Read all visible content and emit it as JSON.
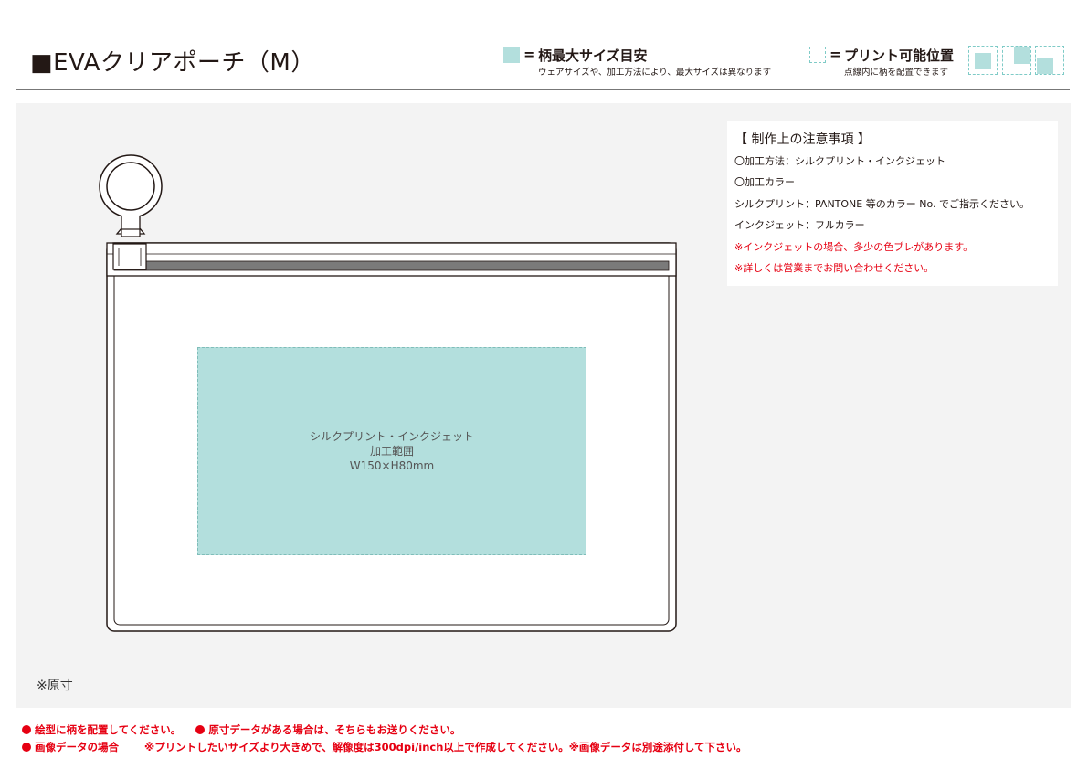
{
  "header": {
    "title": "■EVAクリアポーチ（M）",
    "legend_pattern": {
      "equals": "=",
      "label": "柄最大サイズ目安",
      "note": "ウェアサイズや、加工方法により、最大サイズは異なります",
      "color": "#b3dfdd"
    },
    "legend_position": {
      "equals": "=",
      "label": "プリント可能位置",
      "note": "点線内に柄を配置できます"
    }
  },
  "notes": {
    "heading": "【 制作上の注意事項 】",
    "lines": [
      "〇加工方法：シルクプリント・インクジェット",
      "〇加工カラー",
      "シルクプリント：PANTONE 等のカラー No. でご指示ください。",
      "インクジェット：フルカラー"
    ],
    "warnings": [
      "※インクジェットの場合、多少の色ブレがあります。",
      "※詳しくは営業までお問い合わせください。"
    ],
    "warning_color": "#e60012"
  },
  "print_area": {
    "line1": "シルクプリント・インクジェット",
    "line2": "加工範囲",
    "line3": "W150×H80mm"
  },
  "scale_note": "※原寸",
  "footer": {
    "row1_a": "絵型に柄を配置してください。",
    "row1_b": "原寸データがある場合は、そちらもお送りください。",
    "row2_a": "画像データの場合",
    "row2_b": "※プリントしたいサイズより大きめで、解像度は300dpi/inch以上で作成してください。※画像データは別途添付して下さい。"
  }
}
